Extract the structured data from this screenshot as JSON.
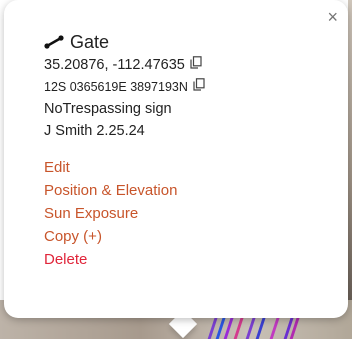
{
  "popup": {
    "title": "Gate",
    "title_icon": "path-segment-icon",
    "coordinates": "35.20876, -112.47635",
    "utm": "12S 0365619E 3897193N",
    "note1": "NoTrespassing sign",
    "note2": "J Smith 2.25.24",
    "close_label": "×",
    "actions": {
      "edit": "Edit",
      "position": "Position & Elevation",
      "sun": "Sun Exposure",
      "copy": "Copy (+)",
      "delete": "Delete"
    }
  },
  "colors": {
    "action": "#c8552b",
    "delete": "#e0253a",
    "text": "#222222"
  }
}
